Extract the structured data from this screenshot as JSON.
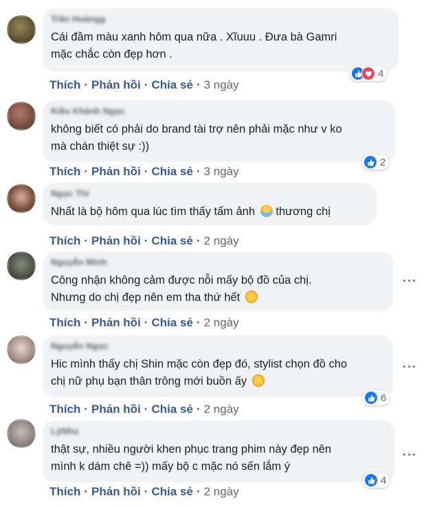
{
  "colors": {
    "link": "#385898",
    "bubble": "#f0f2f5",
    "like_blue": "#1877f2",
    "love_red": "#f33e58"
  },
  "comments": [
    {
      "author": "Trần Hoàngg",
      "lines": [
        "Cái đầm màu xanh hôm qua nữa . Xĩuuu . Đưa bà Gamri",
        "mặc chắc còn đẹp hơn ."
      ],
      "actions": {
        "like": "Thích",
        "reply": "Phản hồi",
        "share": "Chia sẻ",
        "time": "3 ngày"
      },
      "reactions": {
        "icons": [
          "like-icon",
          "love-icon"
        ],
        "count": "4"
      }
    },
    {
      "author": "Kiều Khánh Ngọc",
      "lines": [
        "không biết có phải do brand tài trợ nên phải mặc như v ko",
        "mà chán thiệt sự :))"
      ],
      "actions": {
        "like": "Thích",
        "reply": "Phản hồi",
        "share": "Chia sẻ",
        "time": "3 ngày"
      },
      "reactions": {
        "icons": [
          "like-icon"
        ],
        "count": "2"
      }
    },
    {
      "author": "Ngọc Thi",
      "lines": [
        "Nhất là bộ hôm qua lúc tìm thấy tấm ảnh",
        "thương chị"
      ],
      "actions": {
        "like": "Thích",
        "reply": "Phản hồi",
        "share": "Chia sẻ",
        "time": "2 ngày"
      }
    },
    {
      "author": "Nguyễn Minh",
      "lines": [
        "Công nhận không cảm được nỗi mấy bộ đồ của chị.",
        "Nhưng do chị đẹp nên em tha thứ hết"
      ],
      "actions": {
        "like": "Thích",
        "reply": "Phản hồi",
        "share": "Chia sẻ",
        "time": "2 ngày"
      },
      "more": "···"
    },
    {
      "author": "Nguyễn Ngọc",
      "lines": [
        "Hic mình thấy chị Shin mặc còn đẹp đó, stylist chọn đồ cho",
        "chị nữ phụ bạn thân trông mới buồn ấy"
      ],
      "actions": {
        "like": "Thích",
        "reply": "Phản hồi",
        "share": "Chia sẻ",
        "time": "2 ngày"
      },
      "reactions": {
        "icons": [
          "like-icon"
        ],
        "count": "6"
      },
      "more": "···"
    },
    {
      "author": "LýNhu",
      "lines": [
        "thật sự, nhiều người khen phục trang phim này đẹp nên",
        "mình k dám chê =)) mấy bộ c mặc nó sến lắm ý"
      ],
      "actions": {
        "like": "Thích",
        "reply": "Phản hồi",
        "share": "Chia sẻ",
        "time": "2 ngày"
      },
      "reactions": {
        "icons": [
          "like-icon"
        ],
        "count": "4"
      },
      "more": "···"
    }
  ]
}
